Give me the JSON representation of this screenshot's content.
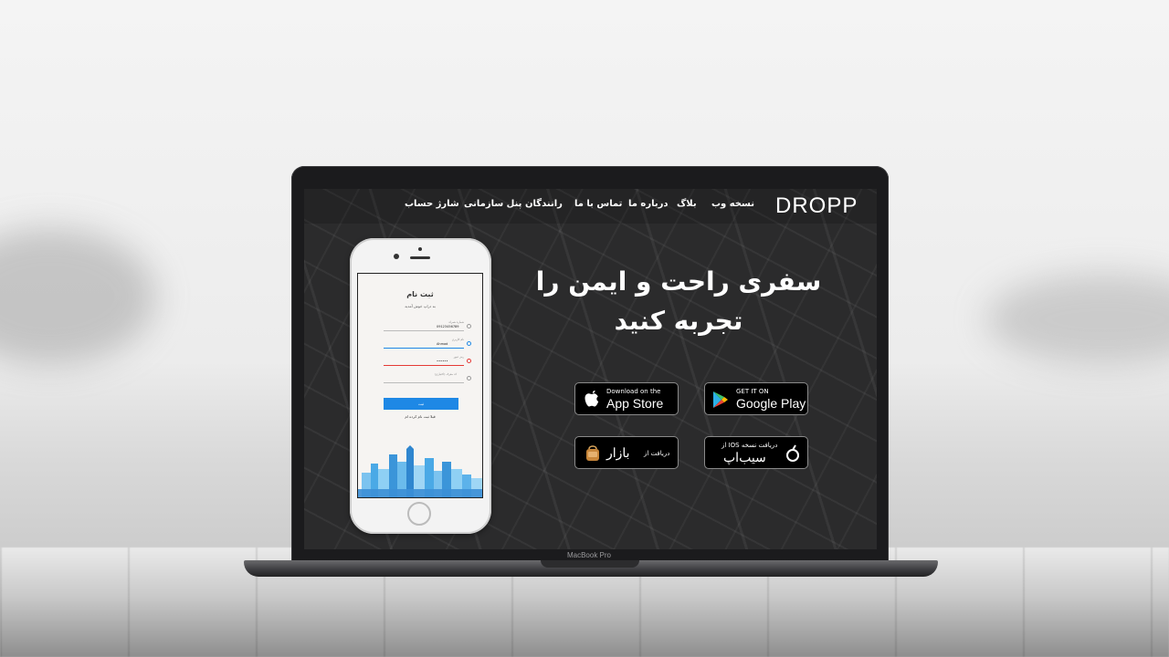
{
  "nav": {
    "logo": "DROPP",
    "items": [
      {
        "label": "نسخه وب"
      },
      {
        "label": "بلاگ"
      },
      {
        "label": "درباره ما"
      },
      {
        "label": "تماس با ما"
      },
      {
        "label": "رانندگان"
      },
      {
        "label": "پنل سازمانی"
      },
      {
        "label": "شارژ حساب"
      }
    ]
  },
  "hero": {
    "line1": "سفری راحت و ایمن را",
    "line2": "تجربه کنید"
  },
  "stores": {
    "appstore": {
      "small": "Download on the",
      "big": "App Store"
    },
    "googleplay": {
      "small": "GET IT ON",
      "big": "Google Play"
    },
    "bazaar": {
      "small": "دریافت از",
      "big": "بازار"
    },
    "sibapp": {
      "small": "دریافت نسخه IOS از",
      "big": "سیب‌اپ"
    }
  },
  "phone": {
    "title": "ثبت نام",
    "subtitle": "به دراپ خوش آمدید",
    "fields": [
      {
        "label": "شماره همراه",
        "value": "09123456789"
      },
      {
        "label": "نام کاربری",
        "value": "Ahmad"
      },
      {
        "label": "رمز عبور",
        "value": "••••••"
      },
      {
        "label": "کد معرف (اختیاری)",
        "value": ""
      }
    ],
    "submit": "ثبت",
    "login_link": "قبلا ثبت نام کرده ام"
  },
  "laptop": {
    "label": "MacBook Pro"
  },
  "colors": {
    "accent": "#1e88e5",
    "screen_bg": "#2b2b2c"
  }
}
